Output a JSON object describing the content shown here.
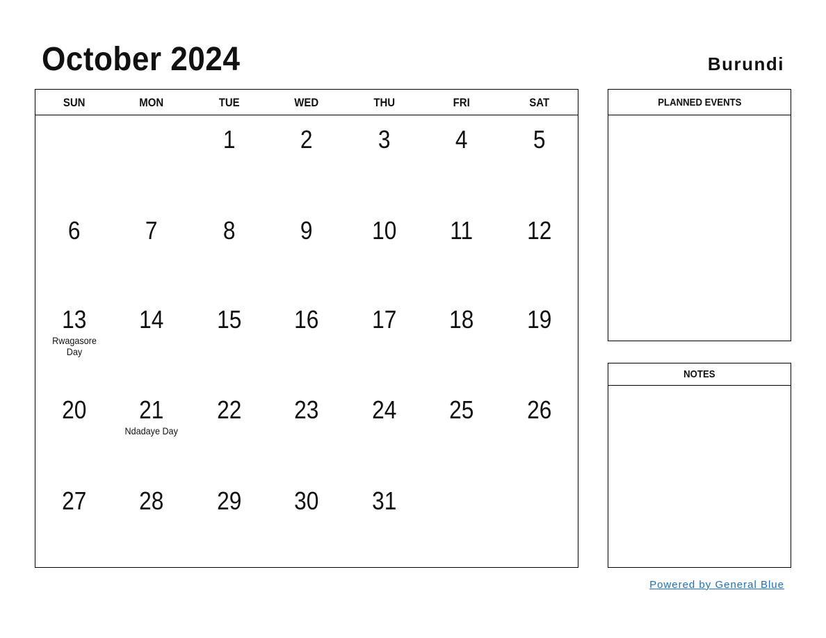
{
  "header": {
    "title": "October 2024",
    "country": "Burundi"
  },
  "calendar": {
    "weekdays": [
      "SUN",
      "MON",
      "TUE",
      "WED",
      "THU",
      "FRI",
      "SAT"
    ],
    "weeks": [
      [
        {
          "d": ""
        },
        {
          "d": ""
        },
        {
          "d": "1"
        },
        {
          "d": "2"
        },
        {
          "d": "3"
        },
        {
          "d": "4"
        },
        {
          "d": "5"
        }
      ],
      [
        {
          "d": "6"
        },
        {
          "d": "7"
        },
        {
          "d": "8"
        },
        {
          "d": "9"
        },
        {
          "d": "10"
        },
        {
          "d": "11"
        },
        {
          "d": "12"
        }
      ],
      [
        {
          "d": "13",
          "h": "Rwagasore Day"
        },
        {
          "d": "14"
        },
        {
          "d": "15"
        },
        {
          "d": "16"
        },
        {
          "d": "17"
        },
        {
          "d": "18"
        },
        {
          "d": "19"
        }
      ],
      [
        {
          "d": "20"
        },
        {
          "d": "21",
          "h": "Ndadaye Day"
        },
        {
          "d": "22"
        },
        {
          "d": "23"
        },
        {
          "d": "24"
        },
        {
          "d": "25"
        },
        {
          "d": "26"
        }
      ],
      [
        {
          "d": "27"
        },
        {
          "d": "28"
        },
        {
          "d": "29"
        },
        {
          "d": "30"
        },
        {
          "d": "31"
        },
        {
          "d": ""
        },
        {
          "d": ""
        }
      ]
    ]
  },
  "panels": {
    "planned_events": "PLANNED EVENTS",
    "notes": "NOTES"
  },
  "footer": {
    "link": "Powered by General Blue",
    "color": "#1f6fbf"
  }
}
